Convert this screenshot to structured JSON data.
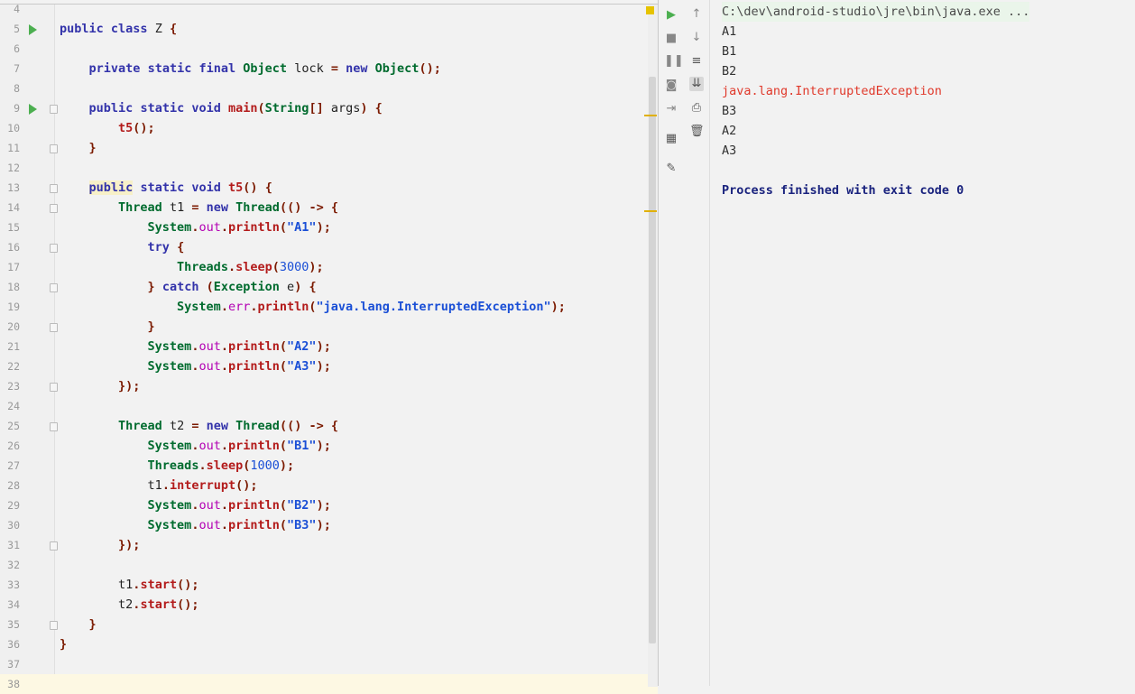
{
  "editor": {
    "lines": [
      {
        "n": "4",
        "t": ""
      },
      {
        "n": "5",
        "t": "public class Z {"
      },
      {
        "n": "6",
        "t": ""
      },
      {
        "n": "7",
        "t": "    private static final Object lock = new Object();"
      },
      {
        "n": "8",
        "t": ""
      },
      {
        "n": "9",
        "t": "    public static void main(String[] args) {"
      },
      {
        "n": "10",
        "t": "        t5();"
      },
      {
        "n": "11",
        "t": "    }"
      },
      {
        "n": "12",
        "t": ""
      },
      {
        "n": "13",
        "t": "    public static void t5() {"
      },
      {
        "n": "14",
        "t": "        Thread t1 = new Thread(() -> {"
      },
      {
        "n": "15",
        "t": "            System.out.println(\"A1\");"
      },
      {
        "n": "16",
        "t": "            try {"
      },
      {
        "n": "17",
        "t": "                Threads.sleep(3000);"
      },
      {
        "n": "18",
        "t": "            } catch (Exception e) {"
      },
      {
        "n": "19",
        "t": "                System.err.println(\"java.lang.InterruptedException\");"
      },
      {
        "n": "20",
        "t": "            }"
      },
      {
        "n": "21",
        "t": "            System.out.println(\"A2\");"
      },
      {
        "n": "22",
        "t": "            System.out.println(\"A3\");"
      },
      {
        "n": "23",
        "t": "        });"
      },
      {
        "n": "24",
        "t": ""
      },
      {
        "n": "25",
        "t": "        Thread t2 = new Thread(() -> {"
      },
      {
        "n": "26",
        "t": "            System.out.println(\"B1\");"
      },
      {
        "n": "27",
        "t": "            Threads.sleep(1000);"
      },
      {
        "n": "28",
        "t": "            t1.interrupt();"
      },
      {
        "n": "29",
        "t": "            System.out.println(\"B2\");"
      },
      {
        "n": "30",
        "t": "            System.out.println(\"B3\");"
      },
      {
        "n": "31",
        "t": "        });"
      },
      {
        "n": "32",
        "t": ""
      },
      {
        "n": "33",
        "t": "        t1.start();"
      },
      {
        "n": "34",
        "t": "        t2.start();"
      },
      {
        "n": "35",
        "t": "    }"
      },
      {
        "n": "36",
        "t": "}"
      },
      {
        "n": "37",
        "t": ""
      },
      {
        "n": "38",
        "t": ""
      }
    ]
  },
  "run_toolbar": {
    "icons": [
      "run-icon",
      "stop-icon",
      "pause-icon",
      "camera-icon",
      "exit-icon",
      "layout-icon",
      "pin-icon"
    ],
    "icons2": [
      "up-arrow-icon",
      "down-arrow-icon",
      "soft-wrap-icon",
      "scroll-to-end-icon",
      "print-icon",
      "trash-icon"
    ]
  },
  "console": {
    "command": "C:\\dev\\android-studio\\jre\\bin\\java.exe ...",
    "output": [
      "A1",
      "B1",
      "B2"
    ],
    "error": "java.lang.InterruptedException",
    "output2": [
      "B3",
      "A2",
      "A3"
    ],
    "finished": "Process finished with exit code 0"
  },
  "colors": {
    "keyword": "#2c2caa",
    "string": "#1a4fd6",
    "error": "#e0392b",
    "run": "#4caf50"
  }
}
